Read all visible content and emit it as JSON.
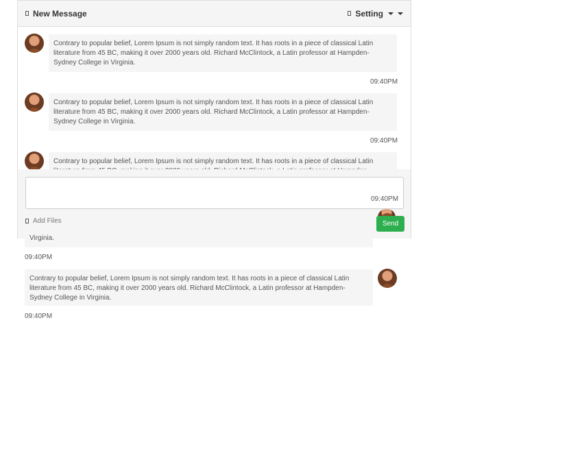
{
  "header": {
    "title": "New Message",
    "setting_label": "Setting",
    "title_icon": "message-icon",
    "setting_icon": "settings-icon"
  },
  "message_text": "Contrary to popular belief, Lorem Ipsum is not simply random text. It has roots in a piece of classical Latin literature from 45 BC, making it over 2000 years old. Richard McClintock, a Latin professor at Hampden-Sydney College in Virginia.",
  "chat": {
    "messages": [
      {
        "text": "Contrary to popular belief, Lorem Ipsum is not simply random text. It has roots in a piece of classical Latin literature from 45 BC, making it over 2000 years old. Richard McClintock, a Latin professor at Hampden-Sydney College in Virginia.",
        "time": "09:40PM"
      },
      {
        "text": "Contrary to popular belief, Lorem Ipsum is not simply random text. It has roots in a piece of classical Latin literature from 45 BC, making it over 2000 years old. Richard McClintock, a Latin professor at Hampden-Sydney College in Virginia.",
        "time": "09:40PM"
      },
      {
        "text": "Contrary to popular belief, Lorem Ipsum is not simply random text. It has roots in a piece of classical Latin literature from 45 BC, making it over 2000 years old. Richard McClintock, a Latin professor at Hampden-Sydney College in",
        "time": "09:40PM"
      }
    ],
    "overflow": [
      {
        "text": "Virginia.",
        "time": "09:40PM"
      },
      {
        "text": "Contrary to popular belief, Lorem Ipsum is not simply random text. It has roots in a piece of classical Latin literature from 45 BC, making it over 2000 years old. Richard McClintock, a Latin professor at Hampden-Sydney College in Virginia.",
        "time": "09:40PM"
      }
    ]
  },
  "footer": {
    "add_files_label": "Add Files",
    "send_label": "Send"
  },
  "colors": {
    "send_button": "#2eaf4f",
    "bubble_bg": "#f5f5f5"
  }
}
